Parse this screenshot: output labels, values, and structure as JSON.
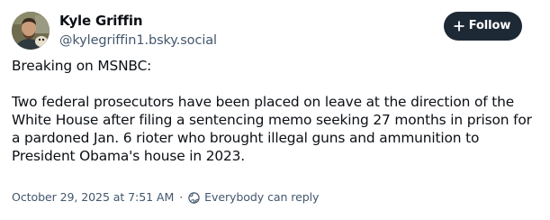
{
  "author": {
    "display_name": "Kyle Griffin",
    "handle": "@kylegriffin1.bsky.social",
    "avatar_icon": "avatar-photo"
  },
  "follow_button": {
    "label": "Follow",
    "icon": "plus-icon",
    "background": "#1e2936",
    "text_color": "#ffffff"
  },
  "post": {
    "intro": "Breaking on MSNBC:",
    "body": "Two federal prosecutors have been placed on leave at the direction of the White House after filing a sentencing memo seeking 27 months in prison for a pardoned Jan. 6 rioter who brought illegal guns and ammunition to President Obama's house in 2023."
  },
  "meta": {
    "timestamp": "October 29, 2025 at 7:51 AM",
    "separator": "·",
    "reply_setting_icon": "globe-icon",
    "reply_setting": "Everybody can reply",
    "muted_color": "#42576c"
  }
}
